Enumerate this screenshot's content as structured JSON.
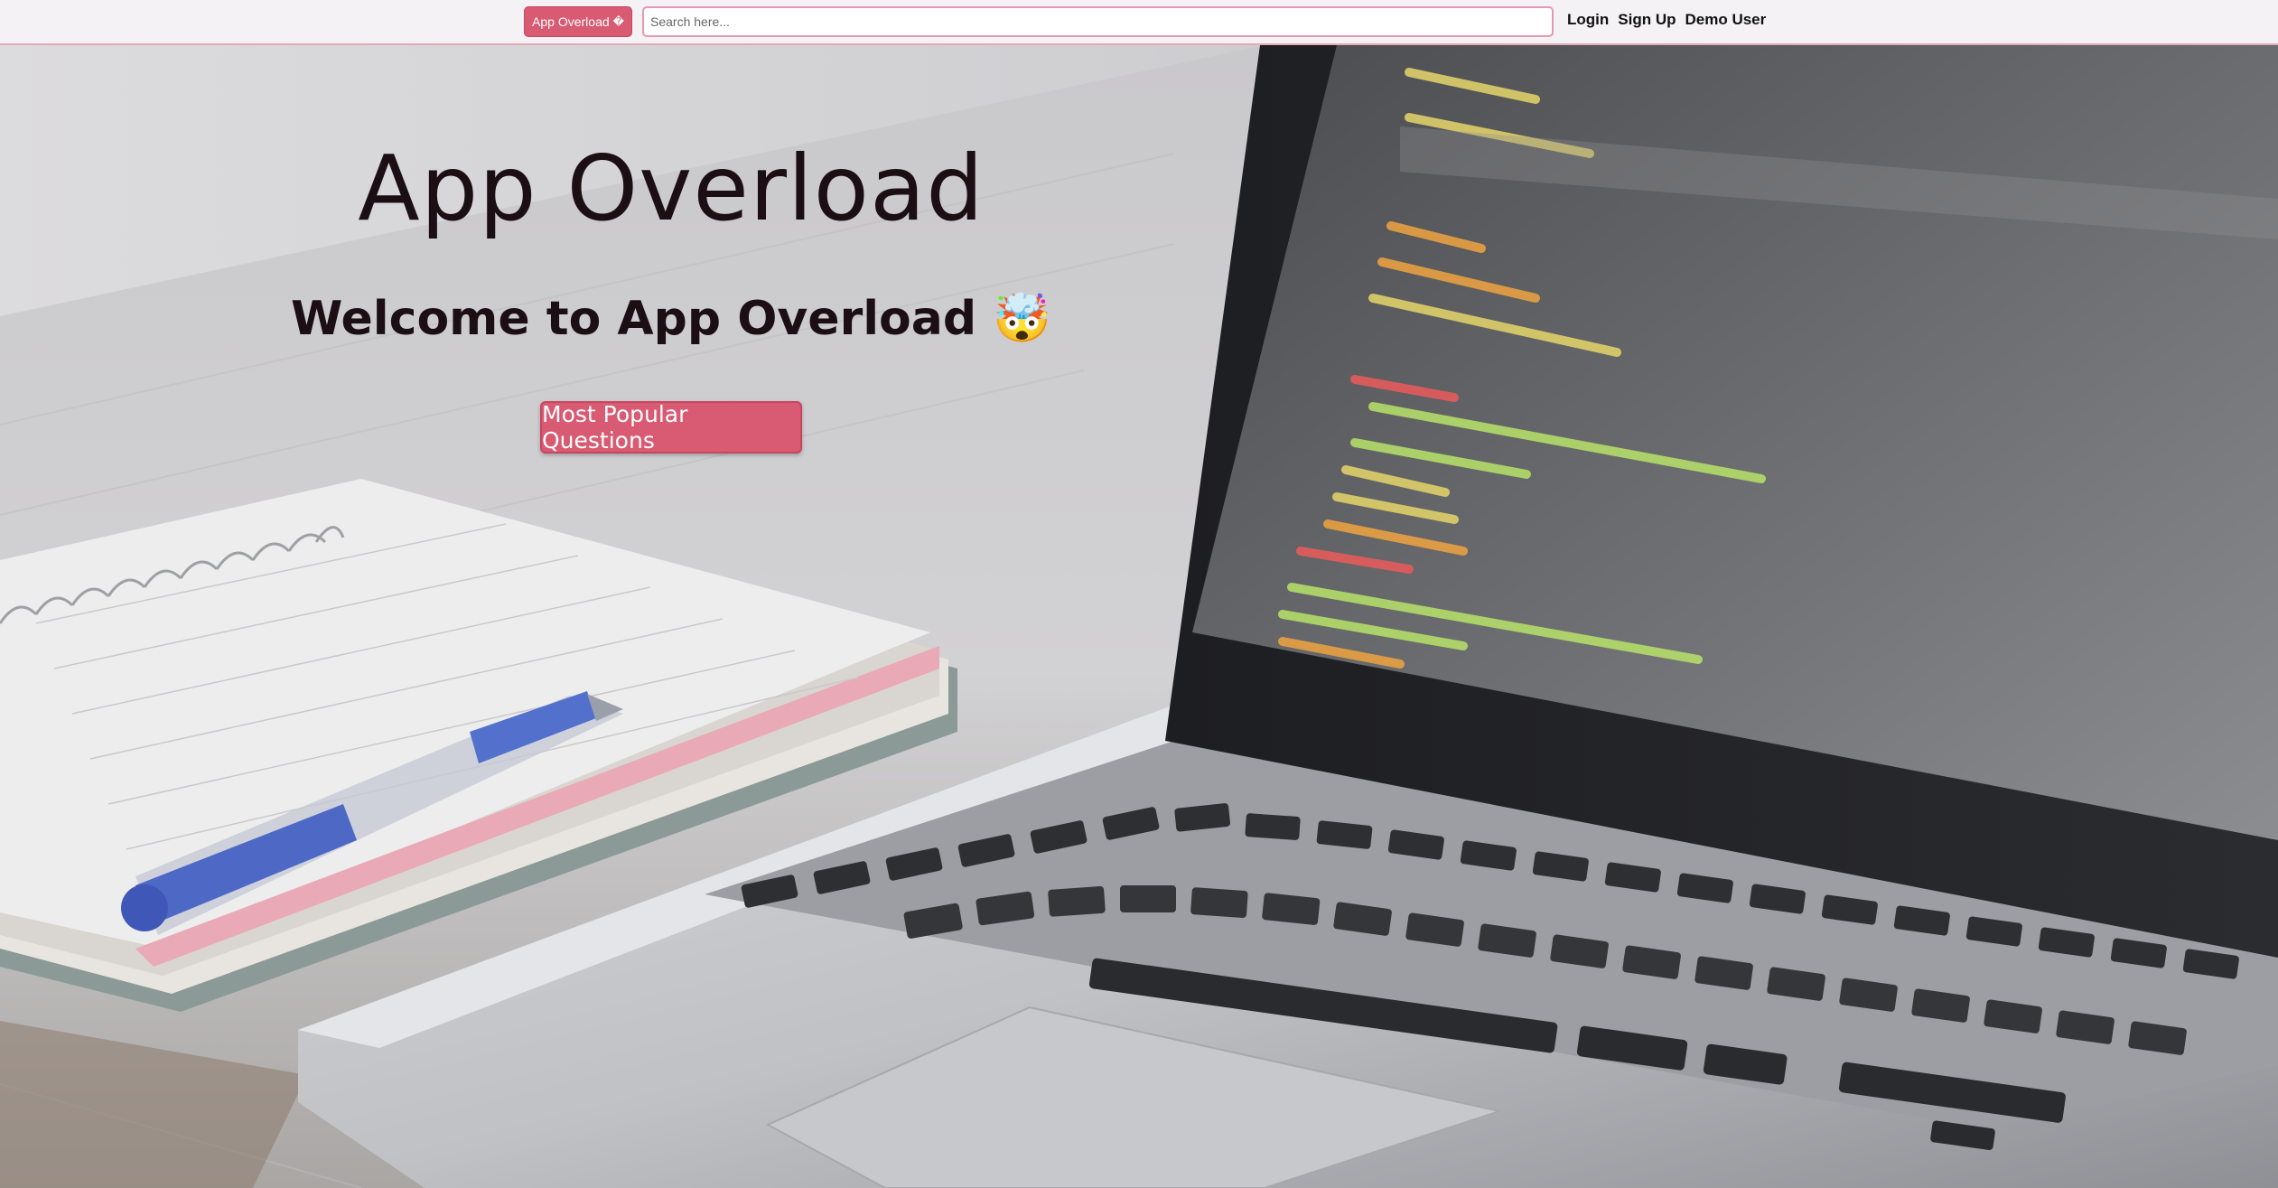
{
  "navbar": {
    "brand_label": "App Overload",
    "brand_glyph": "�",
    "search": {
      "placeholder": "Search here...",
      "value": ""
    },
    "links": [
      "Login",
      "Sign Up",
      "Demo User"
    ]
  },
  "hero": {
    "title": "App Overload",
    "subtitle": "Welcome to App Overload",
    "subtitle_emoji": "🤯",
    "cta_label": "Most Popular Questions"
  },
  "colors": {
    "accent": "#d85a73",
    "navbar_bg": "#f4f2f5",
    "navbar_border": "#e7a7b8",
    "text_dark": "#1c0f14"
  },
  "background_image": {
    "subject": "laptop-with-code-notebook-and-pen"
  }
}
